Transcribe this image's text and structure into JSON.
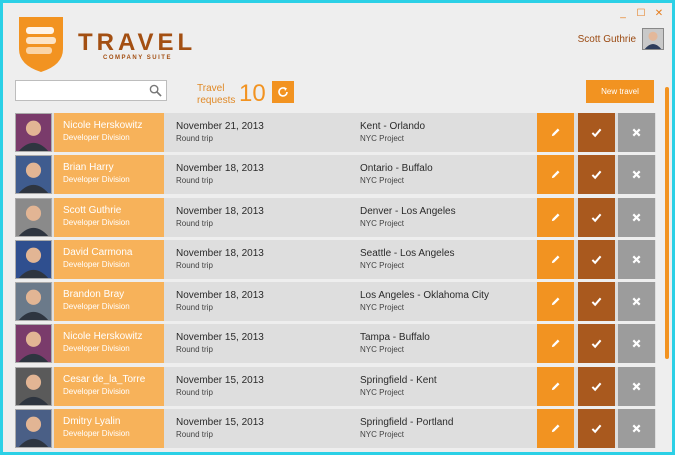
{
  "window": {
    "controls": [
      "minimize",
      "maximize",
      "close"
    ],
    "control_glyphs": [
      "_",
      "☐",
      "✕"
    ]
  },
  "brand": {
    "title": "TRAVEL",
    "subtitle": "COMPANY SUITE"
  },
  "user": {
    "name": "Scott Guthrie"
  },
  "search": {
    "placeholder": "",
    "value": ""
  },
  "requests": {
    "label_line1": "Travel",
    "label_line2": "requests",
    "count": "10"
  },
  "new_travel_label": "New travel",
  "colors": {
    "accent": "#f29321",
    "person_bg": "#f7b25a",
    "approve": "#a9591e",
    "reject": "#9c9c9c",
    "brand": "#a34f12"
  },
  "travels": [
    {
      "name": "Nicole Herskowitz",
      "division": "Developer Division",
      "date": "November 21, 2013",
      "trip": "Round trip",
      "route": "Kent  -  Orlando",
      "project": "NYC Project",
      "avatar_color": "#7a3b6b"
    },
    {
      "name": "Brian Harry",
      "division": "Developer Division",
      "date": "November 18, 2013",
      "trip": "Round trip",
      "route": "Ontario  -  Buffalo",
      "project": "NYC Project",
      "avatar_color": "#3f5c8f"
    },
    {
      "name": "Scott Guthrie",
      "division": "Developer Division",
      "date": "November 18, 2013",
      "trip": "Round trip",
      "route": "Denver  -  Los Angeles",
      "project": "NYC Project",
      "avatar_color": "#8a8a8a"
    },
    {
      "name": "David Carmona",
      "division": "Developer Division",
      "date": "November 18, 2013",
      "trip": "Round trip",
      "route": "Seattle  -  Los Angeles",
      "project": "NYC Project",
      "avatar_color": "#2f4f8f"
    },
    {
      "name": "Brandon Bray",
      "division": "Developer Division",
      "date": "November 18, 2013",
      "trip": "Round trip",
      "route": "Los Angeles  -  Oklahoma City",
      "project": "NYC Project",
      "avatar_color": "#6b7a8a"
    },
    {
      "name": "Nicole Herskowitz",
      "division": "Developer Division",
      "date": "November 15, 2013",
      "trip": "Round trip",
      "route": "Tampa  -  Buffalo",
      "project": "NYC Project",
      "avatar_color": "#7a3b6b"
    },
    {
      "name": "Cesar de_la_Torre",
      "division": "Developer Division",
      "date": "November 15, 2013",
      "trip": "Round trip",
      "route": "Springfield  -  Kent",
      "project": "NYC Project",
      "avatar_color": "#5a5a5a"
    },
    {
      "name": "Dmitry Lyalin",
      "division": "Developer Division",
      "date": "November 15, 2013",
      "trip": "Round trip",
      "route": "Springfield  -  Portland",
      "project": "NYC Project",
      "avatar_color": "#4a5f86"
    }
  ]
}
